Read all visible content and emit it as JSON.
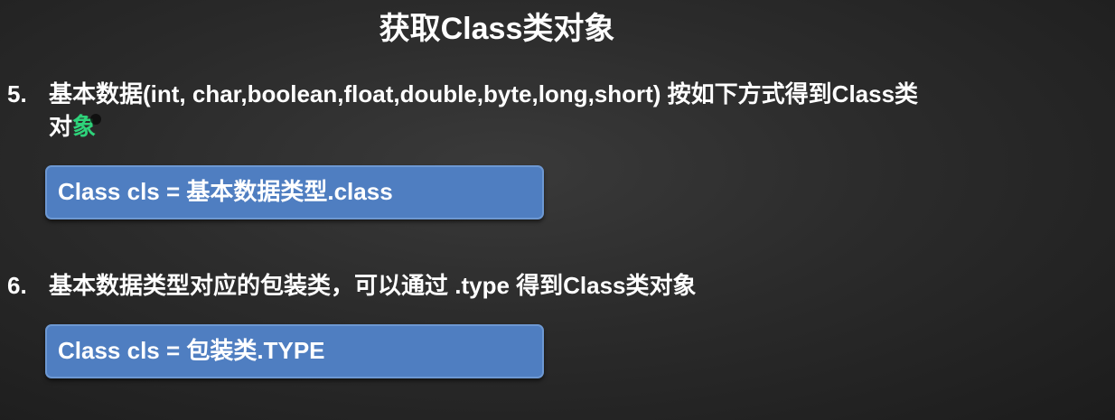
{
  "slide": {
    "title": "获取Class类对象",
    "item5": {
      "number": "5.",
      "text_line1": "基本数据(int, char,boolean,float,double,byte,long,short) 按如下方式得到Class类",
      "text_line2_a": "对",
      "text_line2_b": "象",
      "code": "Class cls = 基本数据类型.class"
    },
    "item6": {
      "number": "6.",
      "text": "基本数据类型对应的包装类，可以通过 .type 得到Class类对象",
      "code": "Class cls = 包装类.TYPE"
    }
  },
  "colors": {
    "box": "#4f7ec1",
    "highlight": "#2ed37a"
  }
}
